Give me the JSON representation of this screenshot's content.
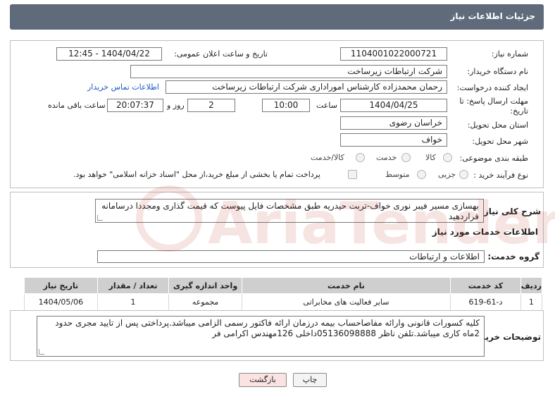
{
  "header": {
    "title": "جزئیات اطلاعات نیاز"
  },
  "form": {
    "need_number_label": "شماره نیاز:",
    "need_number": "1104001022000721",
    "announce_label": "تاریخ و ساعت اعلان عمومی:",
    "announce_value": "1404/04/22 - 12:45",
    "buyer_org_label": "نام دستگاه خریدار:",
    "buyer_org": "شرکت ارتباطات زیرساخت",
    "requester_label": "ایجاد کننده درخواست:",
    "requester": "رحمان محمدزاده کارشناس اموراداری  شرکت ارتباطات زیرساخت",
    "contact_link": "اطلاعات تماس خریدار",
    "deadline_label": "مهلت ارسال پاسخ: تا تاریخ:",
    "deadline_date": "1404/04/25",
    "time_label": "ساعت",
    "deadline_time": "10:00",
    "days_count": "2",
    "days_label": "روز و",
    "remaining_time": "20:07:37",
    "remaining_label": "ساعت باقی مانده",
    "province_label": "استان محل تحویل:",
    "province": "خراسان رضوی",
    "city_label": "شهر محل تحویل:",
    "city": "خواف",
    "category_label": "طبقه بندی موضوعی:",
    "category_options": [
      "کالا",
      "خدمت",
      "کالا/خدمت"
    ],
    "process_label": "نوع فرآیند خرید :",
    "process_options": [
      "جزیی",
      "متوسط"
    ],
    "payment_note": "پرداخت تمام یا بخشی از مبلغ خرید،از محل \"اسناد خزانه اسلامی\" خواهد بود."
  },
  "summary": {
    "label": "شرح کلی نیاز:",
    "text": "بهسازی مسیر فیبر نوری خواف-تربت حیدریه طبق مشخصات فایل پیوست که قیمت گذاری ومجددا درسامانه قراردهید"
  },
  "services": {
    "section_title": "اطلاعات خدمات مورد نیاز",
    "group_label": "گروه خدمت:",
    "group_value": "اطلاعات و ارتباطات",
    "columns": [
      "ردیف",
      "کد خدمت",
      "نام خدمت",
      "واحد اندازه گیری",
      "تعداد / مقدار",
      "تاریخ نیاز"
    ],
    "rows": [
      [
        "1",
        "د-61-619",
        "سایر فعالیت های مخابراتی",
        "مجموعه",
        "1",
        "1404/05/06"
      ]
    ]
  },
  "notes": {
    "label": "توضیحات خریدار:",
    "text": "کلیه کسورات قانونی وارائه مفاصاحساب بیمه درزمان ارائه فاکتور رسمی الزامی میباشد.پرداختی پس از تایید مجری حدود 2ماه کاری میباشد.تلفن ناظر 05136098888داخلی 126مهندس اکرامی فر"
  },
  "buttons": {
    "print": "چاپ",
    "back": "بازگشت"
  },
  "watermark": {
    "text": "AriaTender.neT"
  }
}
